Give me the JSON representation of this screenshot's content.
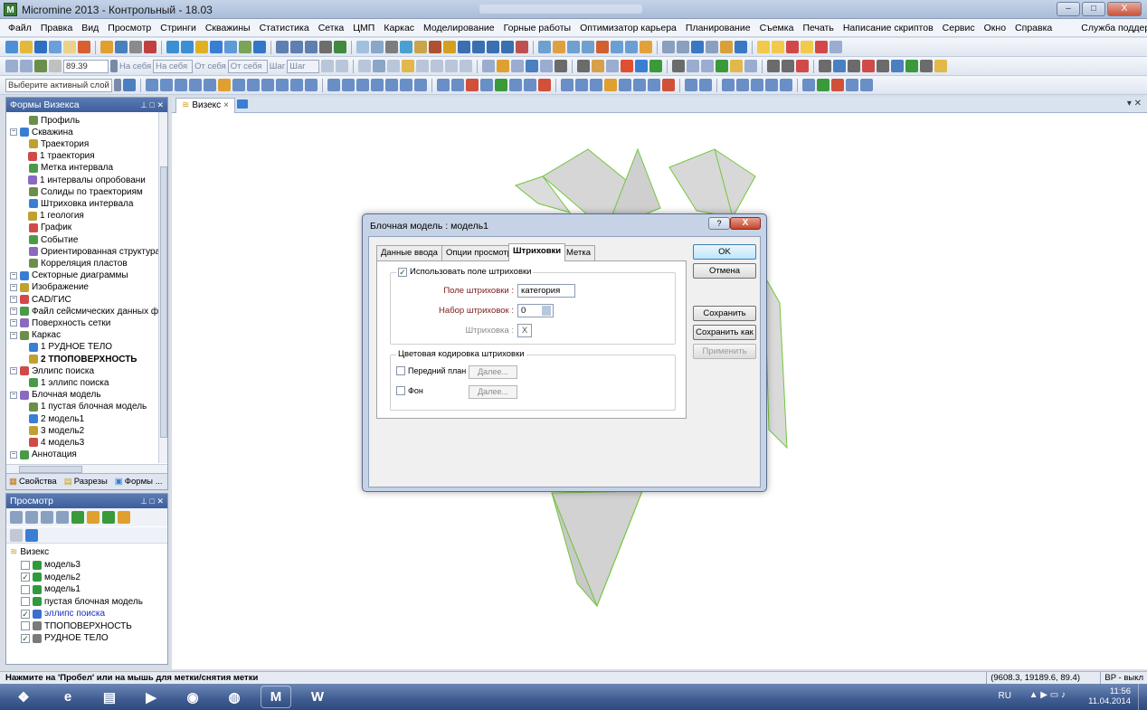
{
  "window": {
    "title": "Micromine 2013 - Контрольный - 18.03",
    "minimize": "–",
    "maximize": "□",
    "close": "X",
    "app_icon": "M"
  },
  "menu": [
    "Файл",
    "Правка",
    "Вид",
    "Просмотр",
    "Стринги",
    "Скважины",
    "Статистика",
    "Сетка",
    "ЦМП",
    "Каркас",
    "Моделирование",
    "Горные работы",
    "Оптимизатор карьера",
    "Планирование",
    "Съемка",
    "Печать",
    "Написание скриптов",
    "Сервис",
    "Окно",
    "Справка",
    "Служба поддержки"
  ],
  "toolbar2": {
    "value": "89.39",
    "to_self_1": "На себя",
    "to_self_2": "На себя",
    "from_self_1": "От себя",
    "from_self_2": "От себя",
    "step_1": "Шаг",
    "step_2": "Шаг"
  },
  "toolbar3": {
    "active_layer": "Выберите активный слой"
  },
  "forms_panel": {
    "title": "Формы Визекса",
    "tree": [
      {
        "label": "Профиль",
        "level": 1,
        "bold": false
      },
      {
        "label": "Скважина",
        "level": 0,
        "bold": false
      },
      {
        "label": "Траектория",
        "level": 1,
        "bold": false
      },
      {
        "label": "1 траектория",
        "level": 2,
        "bold": false
      },
      {
        "label": "Метка интервала",
        "level": 1,
        "bold": false
      },
      {
        "label": "1 интервалы опробовани",
        "level": 2,
        "bold": false
      },
      {
        "label": "Солиды по траекториям",
        "level": 1,
        "bold": false
      },
      {
        "label": "Штриховка интервала",
        "level": 1,
        "bold": false
      },
      {
        "label": "1 геология",
        "level": 2,
        "bold": false
      },
      {
        "label": "График",
        "level": 1,
        "bold": false
      },
      {
        "label": "Событие",
        "level": 1,
        "bold": false
      },
      {
        "label": "Ориентированная структура",
        "level": 1,
        "bold": false
      },
      {
        "label": "Корреляция пластов",
        "level": 1,
        "bold": false
      },
      {
        "label": "Секторные диаграммы",
        "level": 0,
        "bold": false
      },
      {
        "label": "Изображение",
        "level": 0,
        "bold": false
      },
      {
        "label": "CAD/ГИС",
        "level": 0,
        "bold": false
      },
      {
        "label": "Файл сейсмических данных фор",
        "level": 0,
        "bold": false
      },
      {
        "label": "Поверхность сетки",
        "level": 0,
        "bold": false
      },
      {
        "label": "Каркас",
        "level": 0,
        "bold": false
      },
      {
        "label": "1 РУДНОЕ ТЕЛО",
        "level": 1,
        "bold": false
      },
      {
        "label": "2 ТПОПОВЕРХНОСТЬ",
        "level": 1,
        "bold": true
      },
      {
        "label": "Эллипс поиска",
        "level": 0,
        "bold": false
      },
      {
        "label": "1 эллипс поиска",
        "level": 1,
        "bold": false
      },
      {
        "label": "Блочная модель",
        "level": 0,
        "bold": false
      },
      {
        "label": "1 пустая блочная модель",
        "level": 1,
        "bold": false
      },
      {
        "label": "2 модель1",
        "level": 1,
        "bold": false
      },
      {
        "label": "3 модель2",
        "level": 1,
        "bold": false
      },
      {
        "label": "4 модель3",
        "level": 1,
        "bold": false
      },
      {
        "label": "Аннотация",
        "level": 0,
        "bold": false
      }
    ],
    "bottom_tabs": [
      "Свойства",
      "Разрезы",
      "Формы ..."
    ]
  },
  "view_panel": {
    "title": "Просмотр",
    "root": "Визекс",
    "items": [
      {
        "label": "модель3",
        "checked": false,
        "bold": false
      },
      {
        "label": "модель2",
        "checked": true,
        "bold": false
      },
      {
        "label": "модель1",
        "checked": false,
        "bold": false
      },
      {
        "label": "пустая блочная модель",
        "checked": false,
        "bold": false
      },
      {
        "label": "эллипс поиска",
        "checked": true,
        "bold": false,
        "color": "#1a2fc0"
      },
      {
        "label": "ТПОПОВЕРХНОСТЬ",
        "checked": false,
        "bold": false
      },
      {
        "label": "РУДНОЕ ТЕЛО",
        "checked": true,
        "bold": false
      }
    ]
  },
  "doc_tab": {
    "label": "Визекс",
    "close": "×"
  },
  "dialog": {
    "title": "Блочная модель : модель1",
    "help": "?",
    "close": "X",
    "tabs": [
      "Данные ввода",
      "Опции просмотра",
      "Штриховки",
      "Метка"
    ],
    "active_tab": "Штриховки",
    "use_field_label": "Использовать поле штриховки",
    "use_field_checked": true,
    "hatch_field_label": "Поле штриховки :",
    "hatch_field_value": "категория",
    "hatch_set_label": "Набор штриховок :",
    "hatch_set_value": "0",
    "hatch_label": "Штриховка :",
    "hatch_value": "X",
    "color_group_title": "Цветовая кодировка штриховки",
    "foreground_label": "Передний план",
    "background_label": "Фон",
    "next_1": "Далее...",
    "next_2": "Далее...",
    "buttons": {
      "ok": "OK",
      "cancel": "Отмена",
      "save": "Сохранить",
      "save_as": "Сохранить как",
      "apply": "Применить"
    }
  },
  "status": {
    "hint": "Нажмите на 'Пробел' или на мышь для метки/снятия метки",
    "coords": "(9608.3, 19189.6, 89.4)",
    "mode": "BP - выкл"
  },
  "taskbar": {
    "lang": "RU",
    "time": "11:56",
    "date": "11.04.2014",
    "apps": [
      {
        "name": "start-orb",
        "glyph": "❖",
        "color": "#2f7fd9"
      },
      {
        "name": "internet-explorer",
        "glyph": "e",
        "color": "#1e8fe0"
      },
      {
        "name": "explorer",
        "glyph": "▤",
        "color": "#e7c25a"
      },
      {
        "name": "media-center",
        "glyph": "▶",
        "color": "#3c6fd0"
      },
      {
        "name": "chrome",
        "glyph": "◉",
        "color": "#d9483b"
      },
      {
        "name": "firefox",
        "glyph": "◍",
        "color": "#e97a1f"
      },
      {
        "name": "micromine",
        "glyph": "M",
        "color": "#2f9a3d"
      },
      {
        "name": "word",
        "glyph": "W",
        "color": "#2b5fb7"
      }
    ]
  }
}
